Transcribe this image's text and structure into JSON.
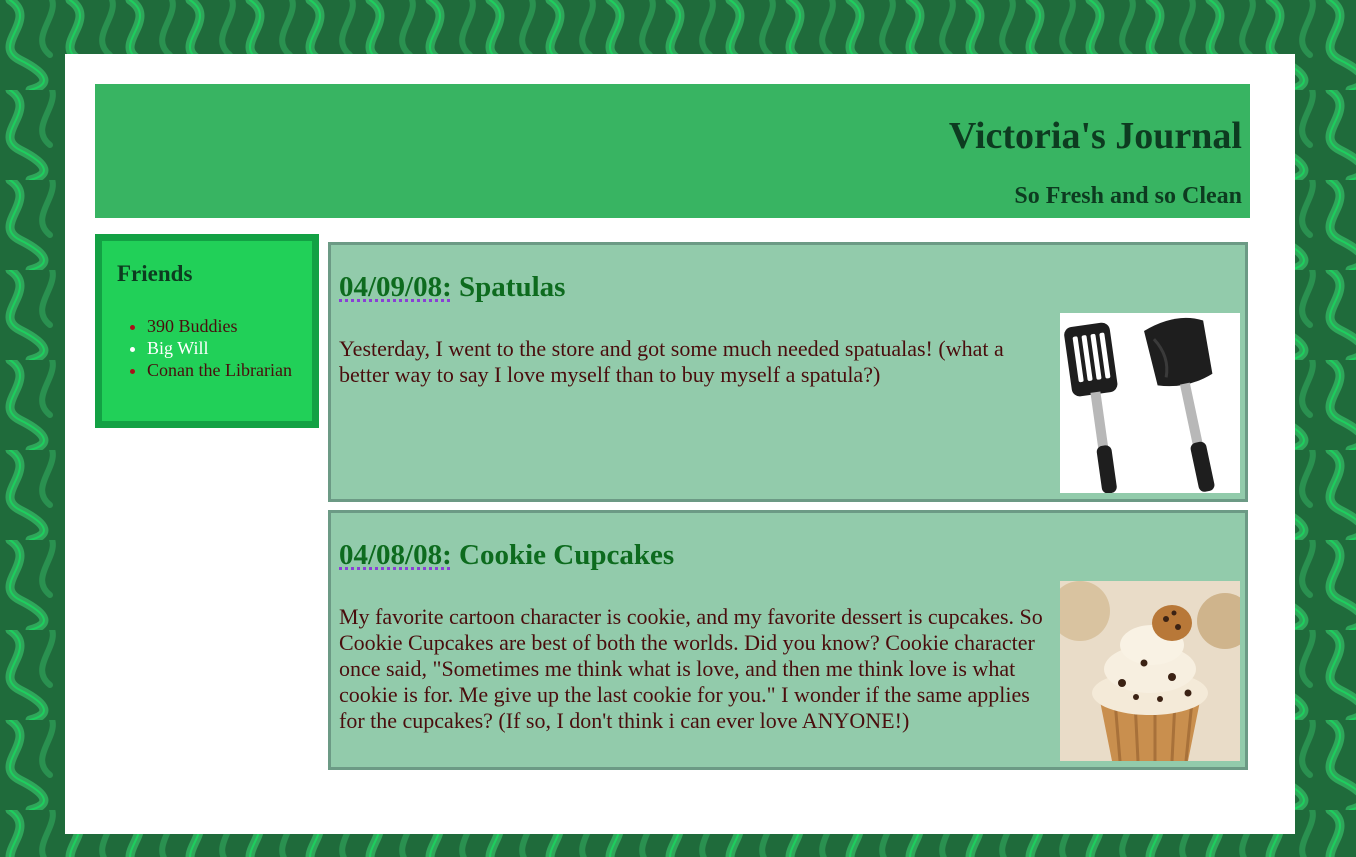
{
  "site": {
    "title": "Victoria's Journal",
    "subtitle": "So Fresh and so Clean"
  },
  "sidebar": {
    "heading": "Friends",
    "friends": [
      {
        "label": "390 Buddies"
      },
      {
        "label": "Big Will"
      },
      {
        "label": "Conan the Librarian"
      }
    ]
  },
  "posts": [
    {
      "date": "04/09/08:",
      "title": "Spatulas",
      "body": "Yesterday, I went to the store and got some much needed spatualas! (what a better way to say I love myself than to buy myself a spatula?)",
      "image": "spatulas-photo"
    },
    {
      "date": "04/08/08:",
      "title": "Cookie Cupcakes",
      "body": "My favorite cartoon character is cookie, and my favorite dessert is cupcakes. So Cookie Cupcakes are best of both the worlds. Did you know? Cookie character once said, \"Sometimes me think what is love, and then me think love is what cookie is for. Me give up the last cookie for you.\" I wonder if the same applies for the cupcakes? (If so, I don't think i can ever love ANYONE!)",
      "image": "cupcake-photo"
    }
  ],
  "colors": {
    "page_background": "#1f6b3b",
    "header": "#38b462",
    "sidebar": "#21d058",
    "post_background": "#92cbab",
    "title_green": "#0d6b1e",
    "body_text": "#4a0d0d"
  }
}
